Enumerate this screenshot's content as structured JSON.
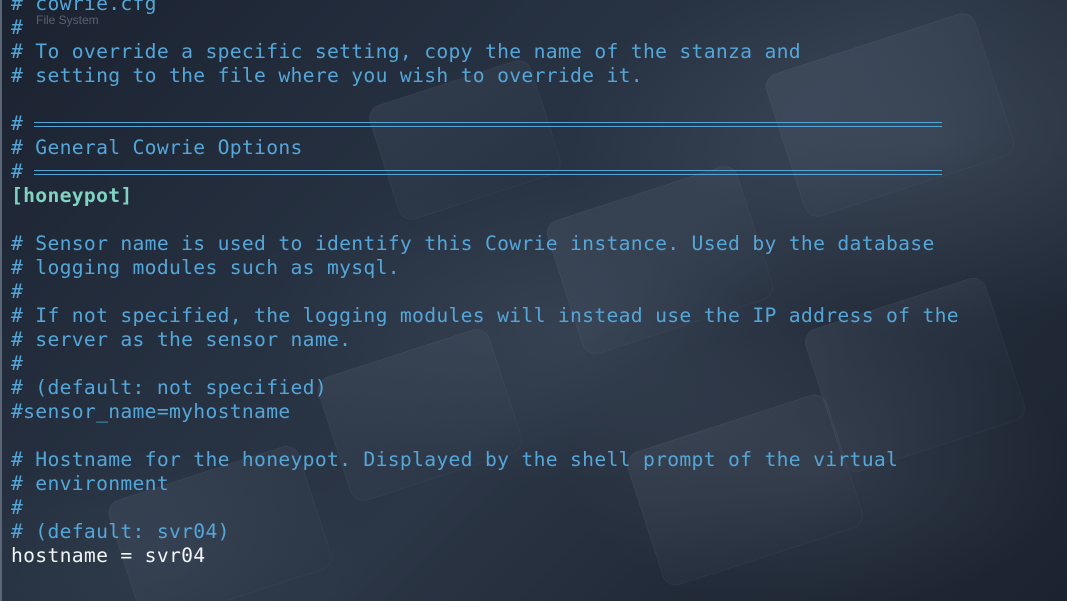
{
  "overlay": {
    "desktop_label": "File System"
  },
  "editor": {
    "lines": [
      {
        "kind": "comment",
        "text": "# cowrie.cfg"
      },
      {
        "kind": "comment",
        "text": "#"
      },
      {
        "kind": "comment",
        "text": "# To override a specific setting, copy the name of the stanza and"
      },
      {
        "kind": "comment",
        "text": "# setting to the file where you wish to override it."
      },
      {
        "kind": "blank",
        "text": ""
      },
      {
        "kind": "rule",
        "text": "#"
      },
      {
        "kind": "comment",
        "text": "# General Cowrie Options"
      },
      {
        "kind": "rule",
        "text": "#"
      },
      {
        "kind": "section",
        "text": "[honeypot]"
      },
      {
        "kind": "blank",
        "text": ""
      },
      {
        "kind": "comment",
        "text": "# Sensor name is used to identify this Cowrie instance. Used by the database"
      },
      {
        "kind": "comment",
        "text": "# logging modules such as mysql."
      },
      {
        "kind": "comment",
        "text": "#"
      },
      {
        "kind": "comment",
        "text": "# If not specified, the logging modules will instead use the IP address of the"
      },
      {
        "kind": "comment",
        "text": "# server as the sensor name."
      },
      {
        "kind": "comment",
        "text": "#"
      },
      {
        "kind": "comment",
        "text": "# (default: not specified)"
      },
      {
        "kind": "comment",
        "text": "#sensor_name=myhostname"
      },
      {
        "kind": "blank",
        "text": ""
      },
      {
        "kind": "comment",
        "text": "# Hostname for the honeypot. Displayed by the shell prompt of the virtual"
      },
      {
        "kind": "comment",
        "text": "# environment"
      },
      {
        "kind": "comment",
        "text": "#"
      },
      {
        "kind": "comment",
        "text": "# (default: svr04)"
      },
      {
        "kind": "plain",
        "text": "hostname = svr04"
      }
    ]
  },
  "colors": {
    "comment": "#55a6d8",
    "section": "#7fd3c0",
    "plain": "#f2f4f6"
  }
}
